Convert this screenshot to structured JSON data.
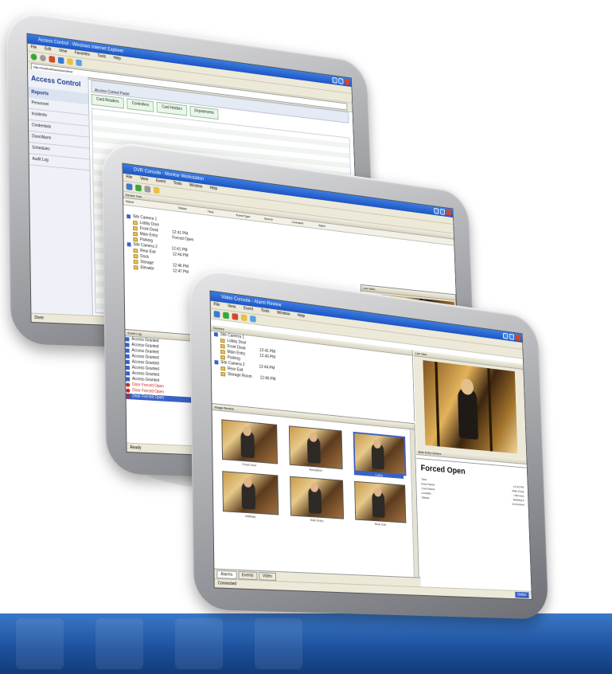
{
  "monitor_back": {
    "title": "Access Control - Windows Internet Explorer",
    "menu": [
      "File",
      "Edit",
      "View",
      "Favorites",
      "Tools",
      "Help"
    ],
    "address": "http://localhost/accesscontrol/",
    "app_title": "Access Control",
    "sidebar_header": "Reports",
    "sidebar_items": [
      "Personnel",
      "Incidents",
      "Credentials",
      "Door/Alarm",
      "Schedules",
      "Audit Log"
    ],
    "content_header": "Access Control Panel",
    "tabs": [
      "Card Readers",
      "Controllers",
      "Card Holders",
      "Departments"
    ],
    "status": "Done"
  },
  "monitor_middle": {
    "title": "DVR Console - Monitor Workstation",
    "menu": [
      "File",
      "View",
      "Event",
      "Tools",
      "Window",
      "Help"
    ],
    "tree_header": "Device Tree",
    "columns": [
      "Name",
      "Status",
      "Time",
      "Event Type",
      "Source",
      "Comment",
      "Alarm"
    ],
    "tree_rows": [
      {
        "label": "Site Camera 1",
        "time": ""
      },
      {
        "label": "Lobby Door",
        "time": ""
      },
      {
        "label": "Front Desk",
        "time": "12:41 PM"
      },
      {
        "label": "Main Entry",
        "time": "Forced Open"
      },
      {
        "label": "Parking",
        "time": ""
      },
      {
        "label": "Site Camera 2",
        "time": "12:41 PM"
      },
      {
        "label": "Rear Exit",
        "time": "12:44 PM"
      },
      {
        "label": "Dock",
        "time": ""
      },
      {
        "label": "Storage",
        "time": "12:46 PM"
      },
      {
        "label": "Elevator",
        "time": "12:47 PM"
      }
    ],
    "video_header": "Live Video",
    "alarm_header": "Event Log",
    "alarm_rows": [
      "Access Granted",
      "Access Granted",
      "Access Granted",
      "Access Granted",
      "Access Granted",
      "Access Granted",
      "Access Granted",
      "Access Granted",
      "Door Forced Open",
      "Door Forced Open",
      "Door Forced Open"
    ],
    "status": "Ready"
  },
  "monitor_front": {
    "title": "Video Console - Alarm Review",
    "menu": [
      "File",
      "View",
      "Event",
      "Tools",
      "Window",
      "Help"
    ],
    "tree_header": "Devices",
    "tree_rows": [
      {
        "label": "Site Camera 1",
        "time": ""
      },
      {
        "label": "Lobby Door",
        "time": ""
      },
      {
        "label": "Front Desk",
        "time": "12:41 PM"
      },
      {
        "label": "Main Entry",
        "time": "12:43 PM"
      },
      {
        "label": "Parking",
        "time": ""
      },
      {
        "label": "Site Camera 2",
        "time": "12:44 PM"
      },
      {
        "label": "Rear Exit",
        "time": ""
      },
      {
        "label": "Storage Room",
        "time": "12:46 PM"
      }
    ],
    "video_header": "Live View",
    "video_caption": "Main Entry Camera",
    "thumbs_header": "Image Review",
    "thumbs": [
      "Front Door",
      "Reception",
      "Lobby",
      "Hallway",
      "Side Entry",
      "Rear Exit"
    ],
    "event_title": "Forced Open",
    "event_fields": [
      {
        "label": "Time",
        "value": "12:43 PM"
      },
      {
        "label": "Door Name",
        "value": "Main Entry"
      },
      {
        "label": "Card Name",
        "value": "Unknown"
      },
      {
        "label": "Location",
        "value": "Building A"
      },
      {
        "label": "Status",
        "value": "Unresolved"
      }
    ],
    "bottom_tabs": [
      "Alarms",
      "Events",
      "Video"
    ],
    "status": "Connected",
    "status_right": "Online"
  },
  "colors": {
    "titlebar": "#1d55c4",
    "chrome": "#ece9d8",
    "bezel": "#9a9ca1",
    "bottom_band": "#1c4f9a",
    "alarm_red": "#c0281d"
  }
}
